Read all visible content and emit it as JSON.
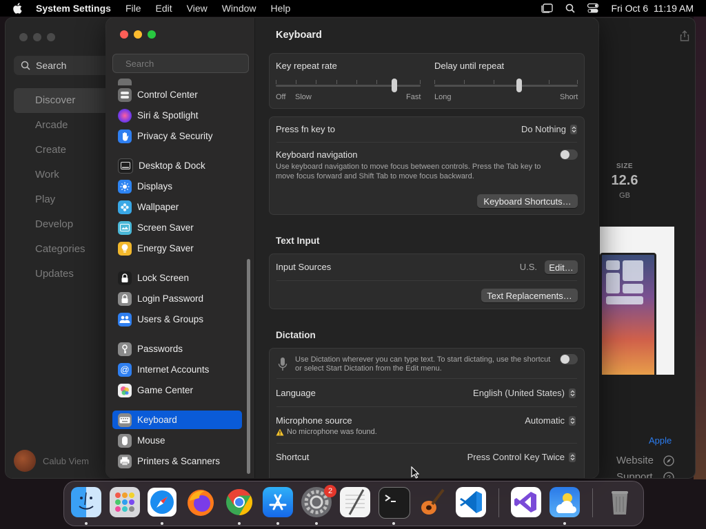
{
  "menubar": {
    "app_name": "System Settings",
    "items": [
      "File",
      "Edit",
      "View",
      "Window",
      "Help"
    ],
    "clock": "Fri Oct 6  11:19 AM"
  },
  "appstore": {
    "search_placeholder": "Search",
    "nav": [
      "Discover",
      "Arcade",
      "Create",
      "Work",
      "Play",
      "Develop",
      "Categories",
      "Updates"
    ],
    "selected": "Discover",
    "user_name": "Calub Viem",
    "size_label": "SIZE",
    "size_value": "12.6",
    "size_unit": "GB",
    "developer_link": "Apple",
    "website_label": "Website",
    "support_label": "Support"
  },
  "sidebar": {
    "search_placeholder": "Search",
    "items": [
      {
        "label": "Control Center",
        "icon": "control-center-icon",
        "color": "#6e6e6e"
      },
      {
        "label": "Siri & Spotlight",
        "icon": "siri-icon",
        "color": "#b03cc8"
      },
      {
        "label": "Privacy & Security",
        "icon": "hand-icon",
        "color": "#2f7ff0"
      },
      {
        "label": "Desktop & Dock",
        "icon": "dock-icon",
        "color": "#1f1f1f"
      },
      {
        "label": "Displays",
        "icon": "sun-icon",
        "color": "#2d84f2"
      },
      {
        "label": "Wallpaper",
        "icon": "flower-icon",
        "color": "#39a8e6"
      },
      {
        "label": "Screen Saver",
        "icon": "screen-saver-icon",
        "color": "#4bb8d8"
      },
      {
        "label": "Energy Saver",
        "icon": "bulb-icon",
        "color": "#f2b82c"
      },
      {
        "label": "Lock Screen",
        "icon": "lock-icon",
        "color": "#1f1f1f"
      },
      {
        "label": "Login Password",
        "icon": "lock-icon",
        "color": "#8a8a8a"
      },
      {
        "label": "Users & Groups",
        "icon": "users-icon",
        "color": "#2f7ff0"
      },
      {
        "label": "Passwords",
        "icon": "key-icon",
        "color": "#8a8a8a"
      },
      {
        "label": "Internet Accounts",
        "icon": "at-icon",
        "color": "#2f7ff0"
      },
      {
        "label": "Game Center",
        "icon": "game-center-icon",
        "color": "#f0f0f0"
      },
      {
        "label": "Keyboard",
        "icon": "keyboard-icon",
        "color": "#8a8a8a"
      },
      {
        "label": "Mouse",
        "icon": "mouse-icon",
        "color": "#8a8a8a"
      },
      {
        "label": "Printers & Scanners",
        "icon": "printer-icon",
        "color": "#8a8a8a"
      }
    ],
    "selected": "Keyboard"
  },
  "content": {
    "title": "Keyboard",
    "key_repeat": {
      "label": "Key repeat rate",
      "min_label": "Off",
      "slow_label": "Slow",
      "max_label": "Fast",
      "level": 0.82
    },
    "delay_repeat": {
      "label": "Delay until repeat",
      "min_label": "Long",
      "max_label": "Short",
      "level": 0.59
    },
    "fn_key": {
      "label": "Press fn key to",
      "value": "Do Nothing"
    },
    "keyboard_nav": {
      "label": "Keyboard navigation",
      "description": "Use keyboard navigation to move focus between controls. Press the Tab key to move focus forward and Shift Tab to move focus backward.",
      "enabled": false
    },
    "shortcuts_button": "Keyboard Shortcuts…",
    "text_input": {
      "heading": "Text Input",
      "sources_label": "Input Sources",
      "sources_value": "U.S.",
      "edit_button": "Edit…",
      "replacements_button": "Text Replacements…"
    },
    "dictation": {
      "heading": "Dictation",
      "description": "Use Dictation wherever you can type text. To start dictating, use the shortcut or select Start Dictation from the Edit menu.",
      "enabled": false,
      "language_label": "Language",
      "language_value": "English (United States)",
      "mic_label": "Microphone source",
      "mic_value": "Automatic",
      "mic_warning": "No microphone was found.",
      "shortcut_label": "Shortcut",
      "shortcut_value": "Press Control Key Twice"
    }
  },
  "dock": {
    "apps": [
      "Finder",
      "Launchpad",
      "Safari",
      "Firefox",
      "Chrome",
      "App Store",
      "System Settings",
      "TextEdit",
      "Terminal",
      "GarageBand",
      "Visual Studio Code",
      "Visual Studio",
      "Weather",
      "Trash"
    ],
    "system_settings_badge": "2"
  }
}
